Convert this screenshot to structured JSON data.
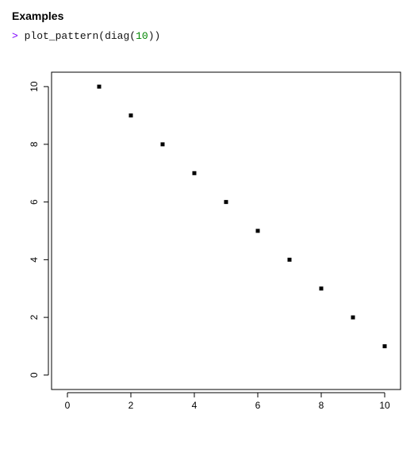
{
  "section_title": "Examples",
  "code": {
    "prompt": ">",
    "fn": "plot_pattern",
    "inner_fn": "diag",
    "arg": "10"
  },
  "chart_data": {
    "type": "scatter",
    "x": [
      1,
      2,
      3,
      4,
      5,
      6,
      7,
      8,
      9,
      10
    ],
    "y": [
      10,
      9,
      8,
      7,
      6,
      5,
      4,
      3,
      2,
      1
    ],
    "xlim": [
      -0.5,
      10.5
    ],
    "ylim": [
      -0.5,
      10.5
    ],
    "x_ticks": [
      0,
      2,
      4,
      6,
      8,
      10
    ],
    "y_ticks": [
      0,
      2,
      4,
      6,
      8,
      10
    ],
    "title": "",
    "xlabel": "",
    "ylabel": ""
  }
}
